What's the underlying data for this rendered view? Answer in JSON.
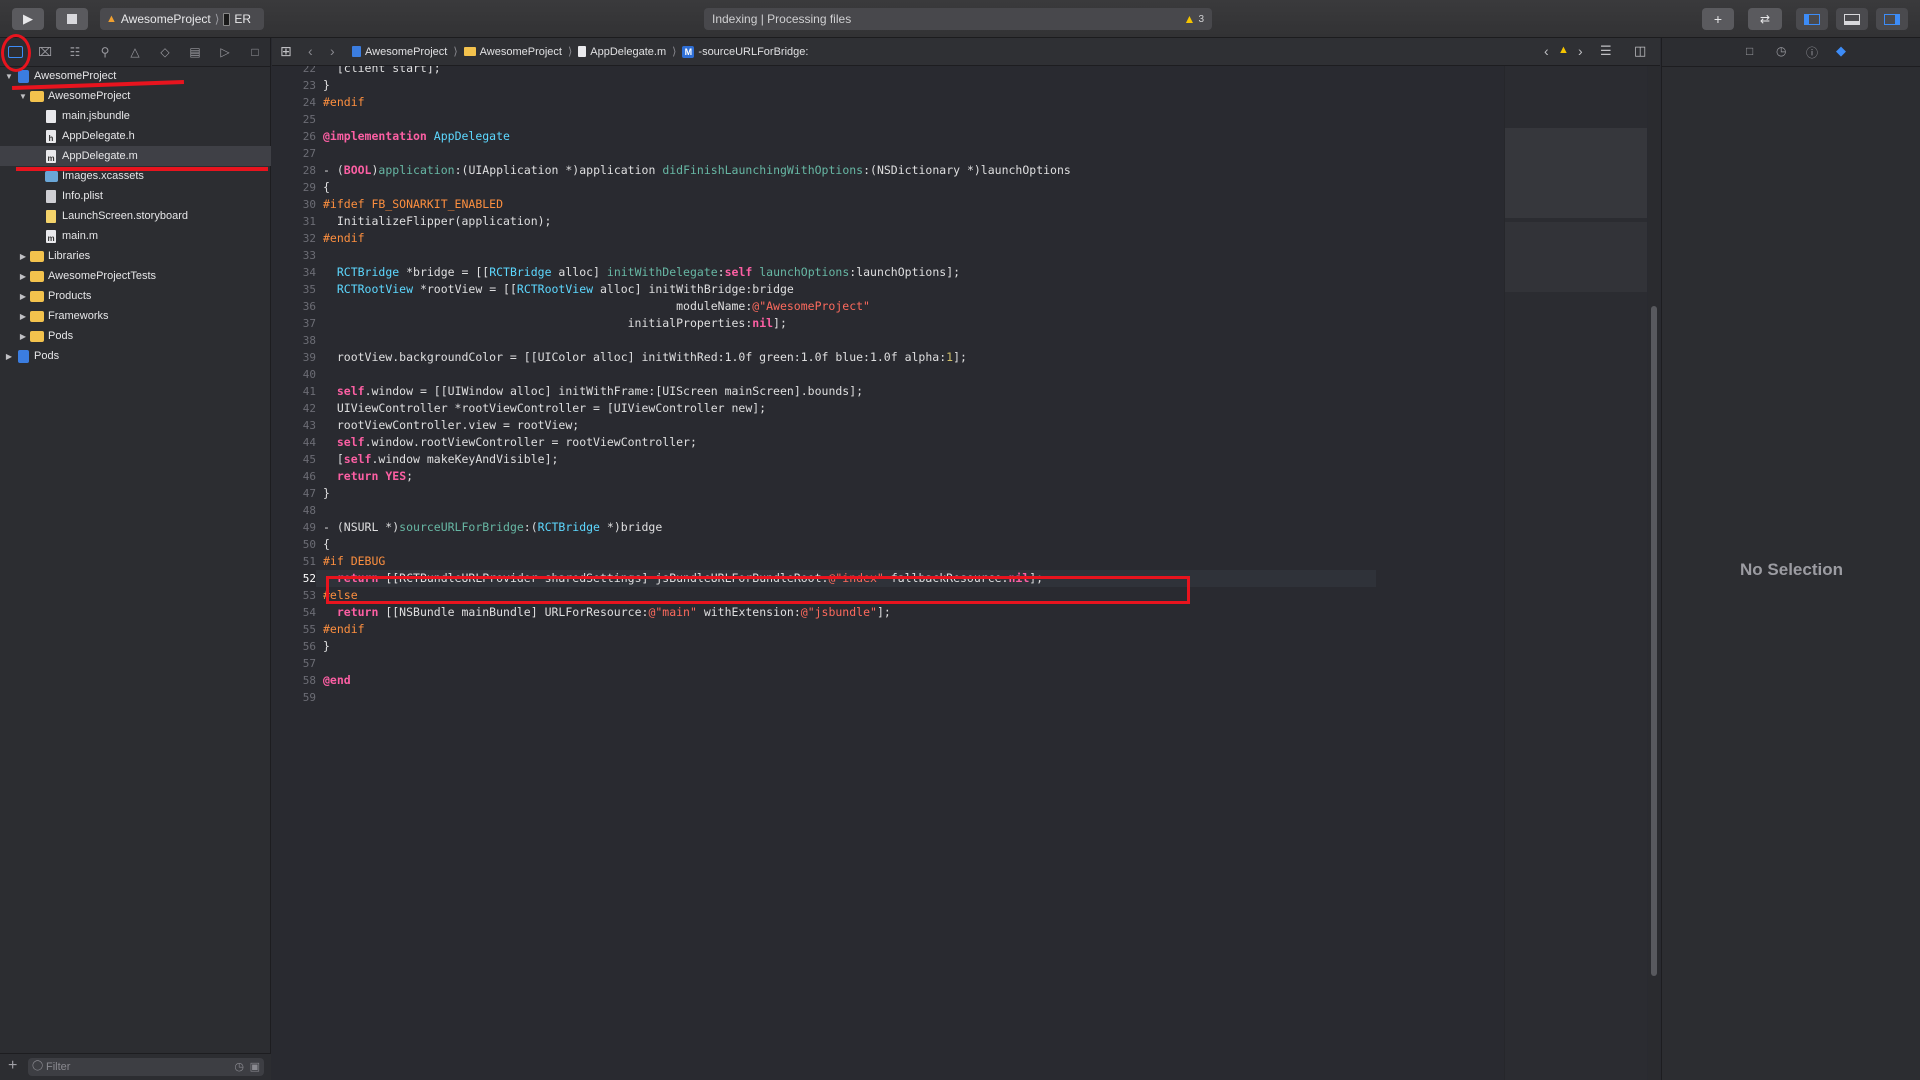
{
  "toolbar": {
    "scheme_project": "AwesomeProject",
    "scheme_device": "ER",
    "activity_status": "Indexing | Processing files",
    "warning_count": "3"
  },
  "navigator": {
    "tree": [
      {
        "label": "AwesomeProject",
        "icon": "project-icon",
        "level": 0,
        "disclosure": "open"
      },
      {
        "label": "AwesomeProject",
        "icon": "folder-icon",
        "level": 1,
        "disclosure": "open"
      },
      {
        "label": "main.jsbundle",
        "icon": "file-icon",
        "level": 2,
        "disclosure": ""
      },
      {
        "label": "AppDelegate.h",
        "icon": "header-file-icon",
        "level": 2,
        "disclosure": ""
      },
      {
        "label": "AppDelegate.m",
        "icon": "objc-file-icon",
        "level": 2,
        "disclosure": "",
        "selected": true
      },
      {
        "label": "Images.xcassets",
        "icon": "asset-catalog-icon",
        "level": 2,
        "disclosure": ""
      },
      {
        "label": "Info.plist",
        "icon": "plist-icon",
        "level": 2,
        "disclosure": ""
      },
      {
        "label": "LaunchScreen.storyboard",
        "icon": "storyboard-icon",
        "level": 2,
        "disclosure": ""
      },
      {
        "label": "main.m",
        "icon": "objc-file-icon",
        "level": 2,
        "disclosure": ""
      },
      {
        "label": "Libraries",
        "icon": "folder-icon",
        "level": 1,
        "disclosure": "closed"
      },
      {
        "label": "AwesomeProjectTests",
        "icon": "folder-icon",
        "level": 1,
        "disclosure": "closed"
      },
      {
        "label": "Products",
        "icon": "folder-icon",
        "level": 1,
        "disclosure": "closed"
      },
      {
        "label": "Frameworks",
        "icon": "folder-icon",
        "level": 1,
        "disclosure": "closed"
      },
      {
        "label": "Pods",
        "icon": "folder-icon",
        "level": 1,
        "disclosure": "closed"
      },
      {
        "label": "Pods",
        "icon": "project-icon",
        "level": 0,
        "disclosure": "closed"
      }
    ],
    "filter_placeholder": "Filter"
  },
  "jumpbar": {
    "crumbs": [
      "AwesomeProject",
      "AwesomeProject",
      "AppDelegate.m",
      "M",
      "-sourceURLForBridge:"
    ]
  },
  "editor": {
    "current_line": 52,
    "lines": [
      {
        "n": 22,
        "t": "  [client start];"
      },
      {
        "n": 23,
        "t": "}"
      },
      {
        "n": 24,
        "t": "#endif"
      },
      {
        "n": 25,
        "t": ""
      },
      {
        "n": 26,
        "t": "@implementation AppDelegate"
      },
      {
        "n": 27,
        "t": ""
      },
      {
        "n": 28,
        "t": "- (BOOL)application:(UIApplication *)application didFinishLaunchingWithOptions:(NSDictionary *)launchOptions"
      },
      {
        "n": 29,
        "t": "{"
      },
      {
        "n": 30,
        "t": "#ifdef FB_SONARKIT_ENABLED"
      },
      {
        "n": 31,
        "t": "  InitializeFlipper(application);"
      },
      {
        "n": 32,
        "t": "#endif"
      },
      {
        "n": 33,
        "t": ""
      },
      {
        "n": 34,
        "t": "  RCTBridge *bridge = [[RCTBridge alloc] initWithDelegate:self launchOptions:launchOptions];"
      },
      {
        "n": 35,
        "t": "  RCTRootView *rootView = [[RCTRootView alloc] initWithBridge:bridge"
      },
      {
        "n": 36,
        "t": "                                                   moduleName:@\"AwesomeProject\""
      },
      {
        "n": 37,
        "t": "                                            initialProperties:nil];"
      },
      {
        "n": 38,
        "t": ""
      },
      {
        "n": 39,
        "t": "  rootView.backgroundColor = [[UIColor alloc] initWithRed:1.0f green:1.0f blue:1.0f alpha:1];"
      },
      {
        "n": 40,
        "t": ""
      },
      {
        "n": 41,
        "t": "  self.window = [[UIWindow alloc] initWithFrame:[UIScreen mainScreen].bounds];"
      },
      {
        "n": 42,
        "t": "  UIViewController *rootViewController = [UIViewController new];"
      },
      {
        "n": 43,
        "t": "  rootViewController.view = rootView;"
      },
      {
        "n": 44,
        "t": "  self.window.rootViewController = rootViewController;"
      },
      {
        "n": 45,
        "t": "  [self.window makeKeyAndVisible];"
      },
      {
        "n": 46,
        "t": "  return YES;"
      },
      {
        "n": 47,
        "t": "}"
      },
      {
        "n": 48,
        "t": ""
      },
      {
        "n": 49,
        "t": "- (NSURL *)sourceURLForBridge:(RCTBridge *)bridge"
      },
      {
        "n": 50,
        "t": "{"
      },
      {
        "n": 51,
        "t": "#if DEBUG"
      },
      {
        "n": 52,
        "t": "  return [[RCTBundleURLProvider sharedSettings] jsBundleURLForBundleRoot:@\"index\" fallbackResource:nil];"
      },
      {
        "n": 53,
        "t": "#else"
      },
      {
        "n": 54,
        "t": "  return [[NSBundle mainBundle] URLForResource:@\"main\" withExtension:@\"jsbundle\"];"
      },
      {
        "n": 55,
        "t": "#endif"
      },
      {
        "n": 56,
        "t": "}"
      },
      {
        "n": 57,
        "t": ""
      },
      {
        "n": 58,
        "t": "@end"
      },
      {
        "n": 59,
        "t": ""
      }
    ]
  },
  "inspector": {
    "empty_label": "No Selection"
  },
  "colors": {
    "accent": "#3d8cf7",
    "annotation": "#e8141e",
    "keyword": "#fc5fa3",
    "preprocessor": "#fd8f3f",
    "string": "#fc6a5d",
    "number": "#d0bf69"
  }
}
